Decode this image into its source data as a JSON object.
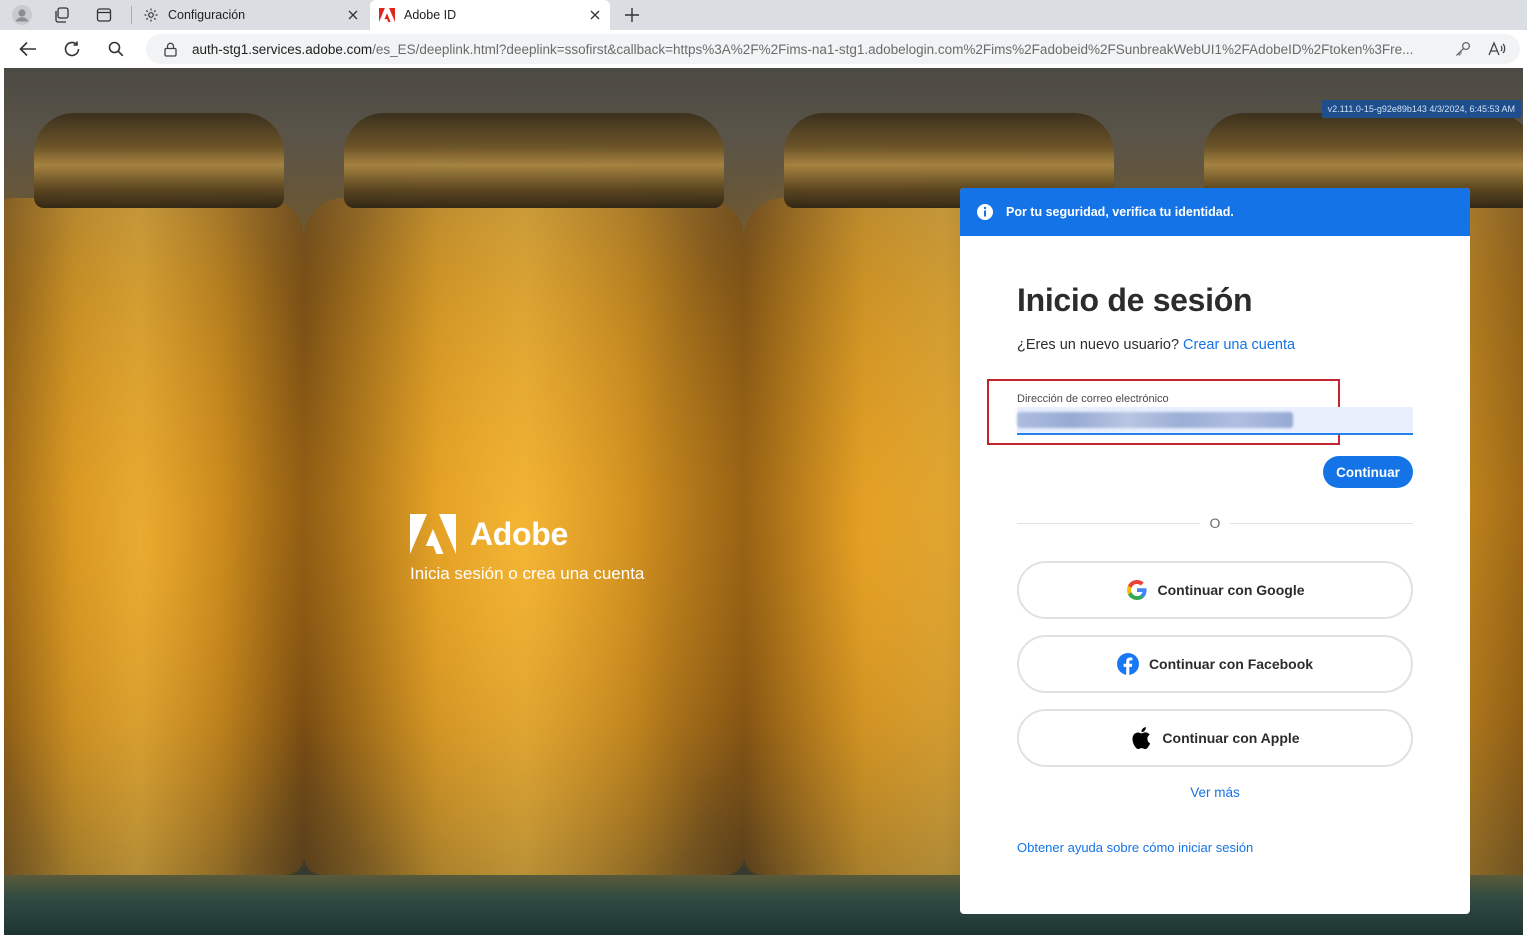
{
  "browser": {
    "tabs": [
      {
        "title": "Configuración",
        "active": false
      },
      {
        "title": "Adobe ID",
        "active": true
      }
    ],
    "address": {
      "host": "auth-stg1.services.adobe.com",
      "path": "/es_ES/deeplink.html?deeplink=ssofirst&callback=https%3A%2F%2Fims-na1-stg1.adobelogin.com%2Fims%2Fadobeid%2FSunbreakWebUI1%2FAdobeID%2Ftoken%3Fre..."
    }
  },
  "page": {
    "version": "v2.111.0-15-g92e89b143 4/3/2024, 6:45:53 AM",
    "brand": {
      "name": "Adobe",
      "tagline": "Inicia sesión o crea una cuenta"
    },
    "card": {
      "notice": "Por tu seguridad, verifica tu identidad.",
      "heading": "Inicio de sesión",
      "new_user_prompt": "¿Eres un nuevo usuario?",
      "create_account": "Crear una cuenta",
      "email_label": "Dirección de correo electrónico",
      "continue_label": "Continuar",
      "or_label": "O",
      "social": [
        {
          "label": "Continuar con Google",
          "icon": "google-icon"
        },
        {
          "label": "Continuar con Facebook",
          "icon": "facebook-icon"
        },
        {
          "label": "Continuar con Apple",
          "icon": "apple-icon"
        }
      ],
      "see_more": "Ver más",
      "help": "Obtener ayuda sobre cómo iniciar sesión"
    }
  },
  "colors": {
    "accent": "#1473e6",
    "highlight": "#c2252f"
  }
}
